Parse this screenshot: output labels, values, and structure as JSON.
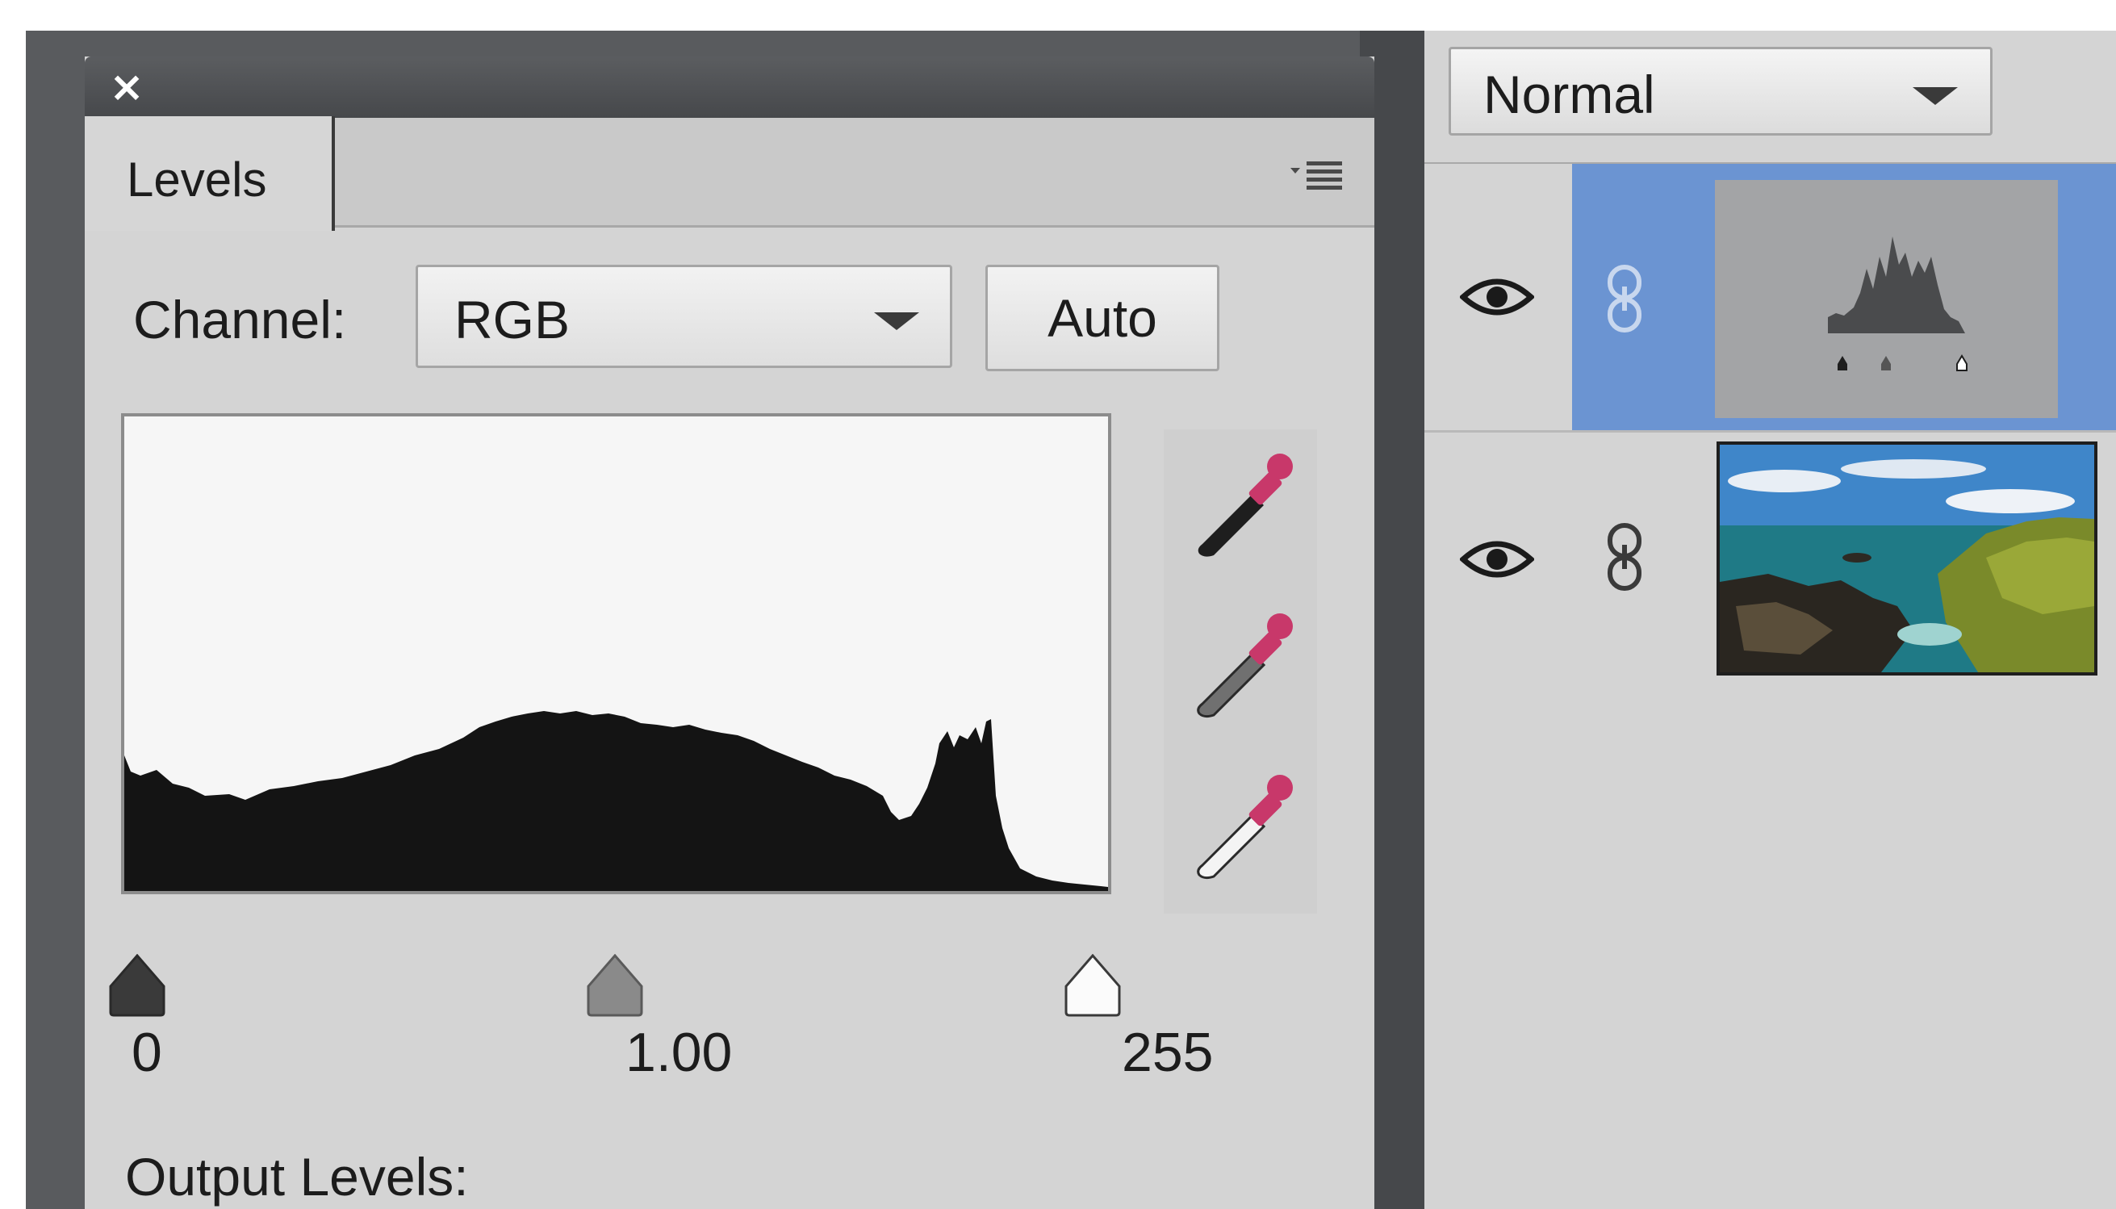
{
  "levels_panel": {
    "tab_label": "Levels",
    "channel_label": "Channel:",
    "channel_value": "RGB",
    "auto_label": "Auto",
    "input_black": "0",
    "input_gamma": "1.00",
    "input_white": "255",
    "output_label": "Output Levels:"
  },
  "layers_panel": {
    "blend_mode": "Normal"
  },
  "icons": {
    "close": "close-icon",
    "panel_menu": "panel-menu-icon",
    "dropdown": "chevron-down-icon",
    "black_eyedropper": "eyedropper-black-icon",
    "gray_eyedropper": "eyedropper-gray-icon",
    "white_eyedropper": "eyedropper-white-icon",
    "visibility": "eye-icon",
    "link": "link-icon"
  },
  "colors": {
    "selected_layer": "#6b94d2",
    "panel": "#d4d4d4",
    "titlebar": "#4e5053",
    "eyedropper_tip": "#c8386a"
  }
}
